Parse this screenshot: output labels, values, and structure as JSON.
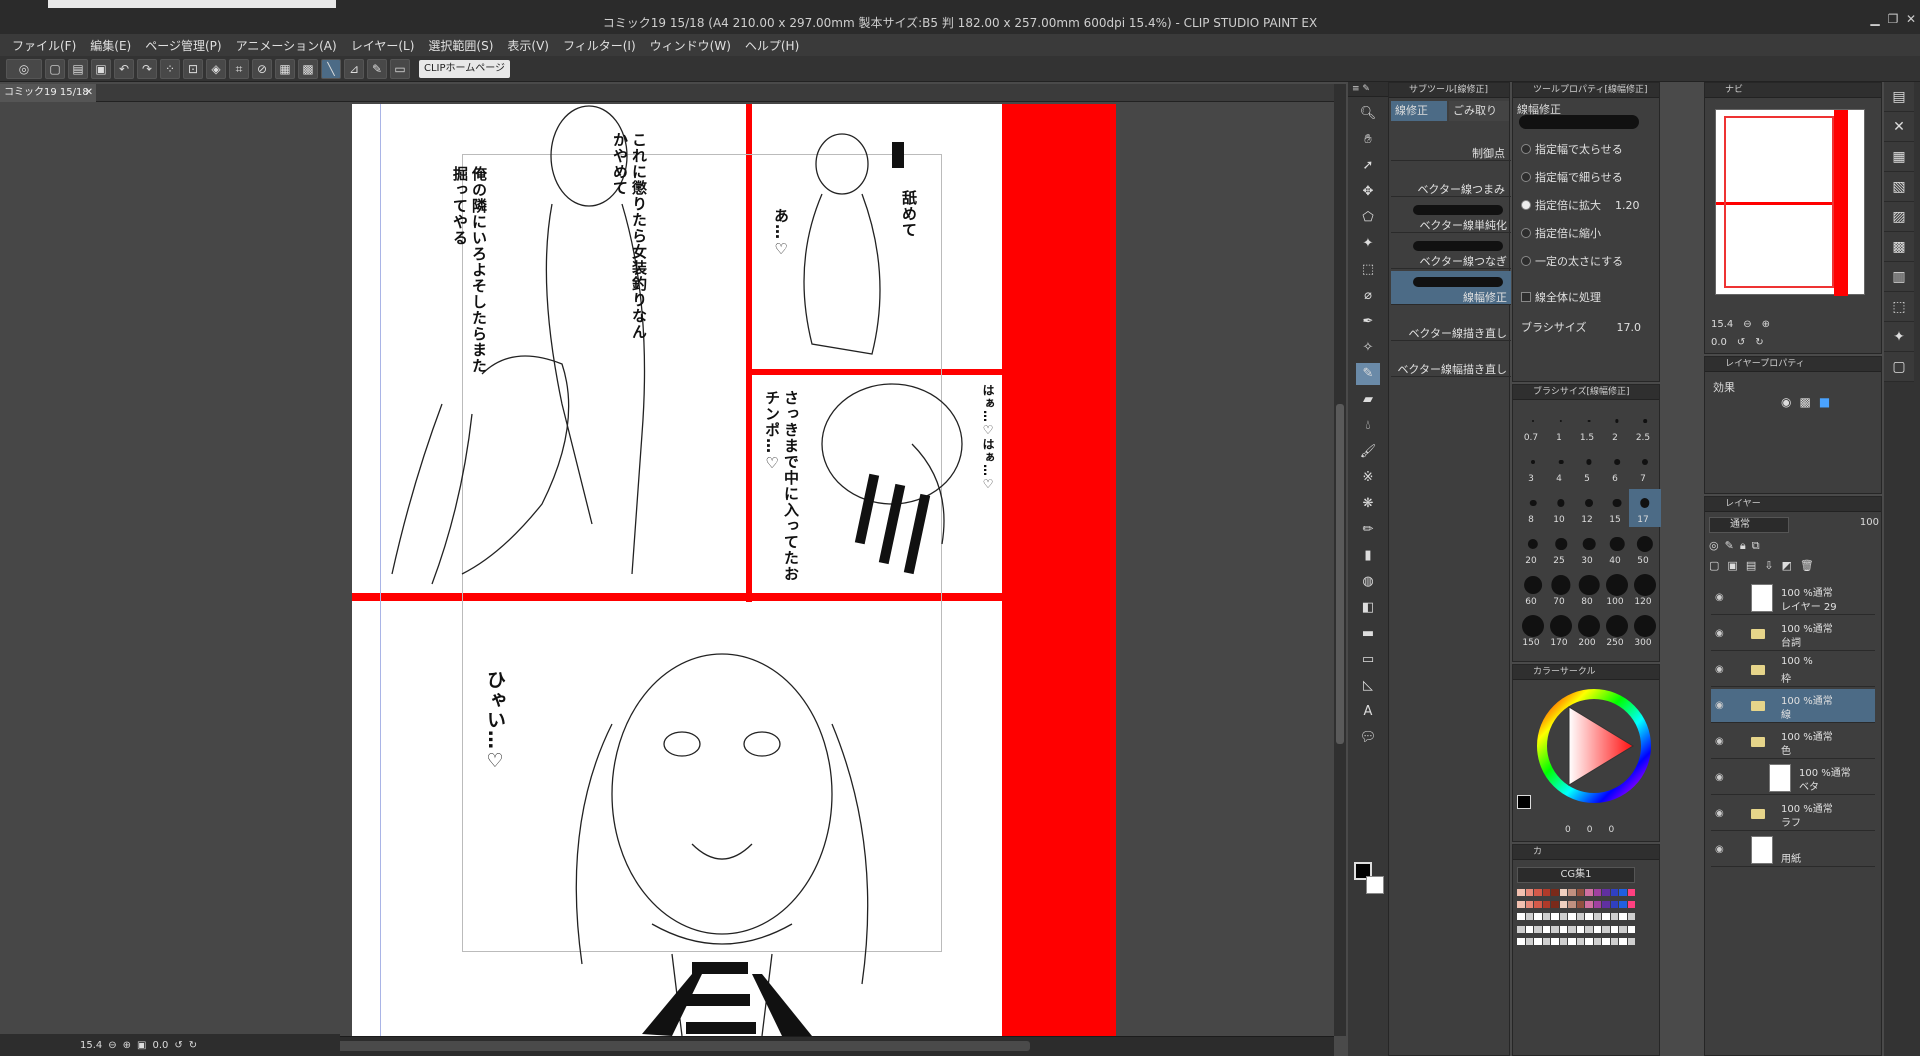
{
  "window": {
    "title": "コミック19 15/18 (A4 210.00 x 297.00mm 製本サイズ:B5 判 182.00 x 257.00mm 600dpi 15.4%) - CLIP STUDIO PAINT EX",
    "minimize": "▁",
    "restore": "❐",
    "close": "✕"
  },
  "menu": [
    "ファイル(F)",
    "編集(E)",
    "ページ管理(P)",
    "アニメーション(A)",
    "レイヤー(L)",
    "選択範囲(S)",
    "表示(V)",
    "フィルター(I)",
    "ウィンドウ(W)",
    "ヘルプ(H)"
  ],
  "commandbar": {
    "clip_home": "CLIPホームページ"
  },
  "document": {
    "tab_label": "コミック19 15/18",
    "close_glyph": "✕"
  },
  "manga": {
    "panel1_text_a": "これに懲りたら女装釣りなんかやめて",
    "panel1_text_b": "俺の隣にいろよそしたらまた掘ってやる",
    "panel2_text_a": "舐めて",
    "panel2_text_b": "あ…♡",
    "panel3_text_a": "はぁ…♡はぁ…♡",
    "panel3_text_b": "さっきまで中に入ってたおチンポ…♡",
    "panel4_text": "ひゃい…♡",
    "colors": {
      "red": "#ff0000",
      "ink": "#111111",
      "paper": "#ffffff"
    }
  },
  "status": {
    "zoom": "15.4",
    "rotation": "0.0"
  },
  "subtool": {
    "header": "サブツール[線修正]",
    "tab_a": "線修正",
    "tab_b": "ごみ取り",
    "items": [
      "制御点",
      "ベクター線つまみ",
      "ベクター線単純化",
      "ベクター線つなぎ",
      "線幅修正",
      "ベクター線描き直し",
      "ベクター線幅描き直し"
    ],
    "selected_index": 4
  },
  "toolprop": {
    "header": "ツールプロパティ[線幅修正]",
    "title": "線幅修正",
    "options": [
      "指定幅で太らせる",
      "指定幅で細らせる",
      "指定倍に拡大",
      "指定倍に縮小",
      "一定の太さにする"
    ],
    "selected_option": 2,
    "scale_value": "1.20",
    "whole_line": "線全体に処理",
    "brush_size_label": "ブラシサイズ",
    "brush_size_value": "17.0"
  },
  "brushsize": {
    "header": "ブラシサイズ[線幅修正]",
    "sizes": [
      "0.7",
      "1",
      "1.5",
      "2",
      "2.5",
      "3",
      "4",
      "5",
      "6",
      "7",
      "8",
      "10",
      "12",
      "15",
      "17",
      "20",
      "25",
      "30",
      "40",
      "50",
      "60",
      "70",
      "80",
      "100",
      "120",
      "150",
      "170",
      "200",
      "250",
      "300"
    ],
    "selected_index": 14
  },
  "colorcircle": {
    "header": "カラーサークル",
    "values": [
      "0",
      "0",
      "0"
    ]
  },
  "colorset": {
    "header_tabs": [
      "カ"
    ],
    "set_name": "CG集1"
  },
  "navigator": {
    "header": "ナビ",
    "zoom": "15.4",
    "rotation": "0.0"
  },
  "layerprop": {
    "header": "レイヤープロパティ",
    "effect_label": "効果"
  },
  "layers": {
    "header": "レイヤー",
    "blend_mode": "通常",
    "opacity": "100",
    "rows": [
      {
        "line1": "100 %通常",
        "line2": "レイヤー 29",
        "type": "raster"
      },
      {
        "line1": "100 %通常",
        "line2": "台詞",
        "type": "folder"
      },
      {
        "line1": "100 %",
        "line2": "枠",
        "type": "folder"
      },
      {
        "line1": "100 %通常",
        "line2": "線",
        "type": "folder"
      },
      {
        "line1": "100 %通常",
        "line2": "色",
        "type": "folder-open"
      },
      {
        "line1": "100 %通常",
        "line2": "ベタ",
        "type": "raster-child"
      },
      {
        "line1": "100 %通常",
        "line2": "ラフ",
        "type": "folder"
      },
      {
        "line1": "",
        "line2": "用紙",
        "type": "paper"
      }
    ],
    "selected_index": 3
  }
}
